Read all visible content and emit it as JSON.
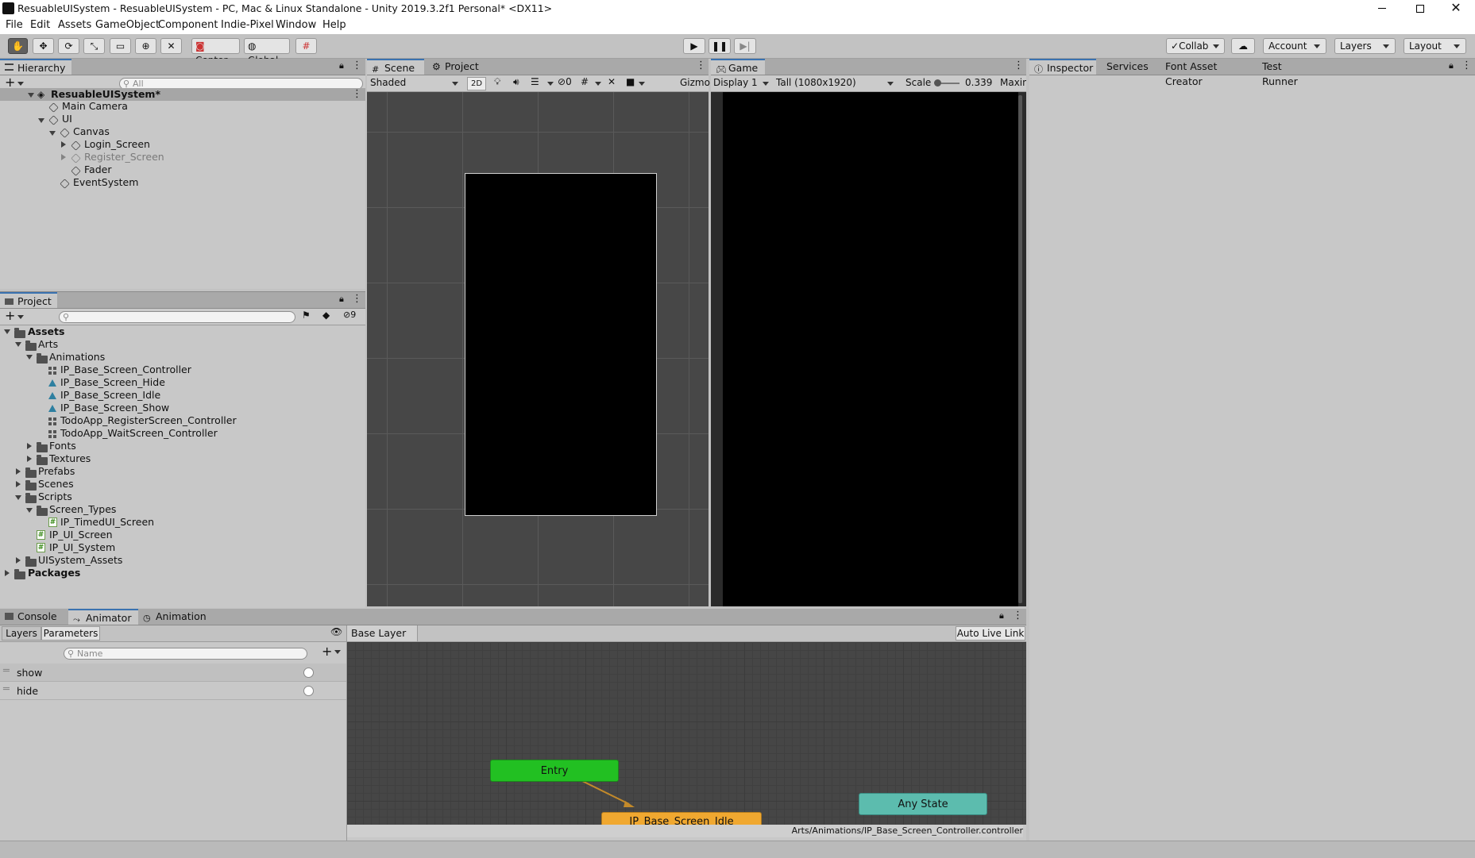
{
  "window": {
    "title": "ResuableUISystem - ResuableUISystem - PC, Mac & Linux Standalone - Unity 2019.3.2f1 Personal* <DX11>"
  },
  "menu": [
    "File",
    "Edit",
    "Assets",
    "GameObject",
    "Component",
    "Indie-Pixel",
    "Window",
    "Help"
  ],
  "toolbar": {
    "pivot": "Center",
    "space": "Global",
    "collab": "Collab",
    "account": "Account",
    "layers": "Layers",
    "layout": "Layout"
  },
  "hierarchy": {
    "tab": "Hierarchy",
    "search_placeholder": "All",
    "items": [
      {
        "label": "ResuableUISystem*"
      },
      {
        "label": "Main Camera"
      },
      {
        "label": "UI"
      },
      {
        "label": "Canvas"
      },
      {
        "label": "Login_Screen"
      },
      {
        "label": "Register_Screen"
      },
      {
        "label": "Fader"
      },
      {
        "label": "EventSystem"
      }
    ]
  },
  "project": {
    "tab": "Project",
    "hidden_count": "9",
    "items": [
      {
        "label": "Assets"
      },
      {
        "label": "Arts"
      },
      {
        "label": "Animations"
      },
      {
        "label": "IP_Base_Screen_Controller"
      },
      {
        "label": "IP_Base_Screen_Hide"
      },
      {
        "label": "IP_Base_Screen_Idle"
      },
      {
        "label": "IP_Base_Screen_Show"
      },
      {
        "label": "TodoApp_RegisterScreen_Controller"
      },
      {
        "label": "TodoApp_WaitScreen_Controller"
      },
      {
        "label": "Fonts"
      },
      {
        "label": "Textures"
      },
      {
        "label": "Prefabs"
      },
      {
        "label": "Scenes"
      },
      {
        "label": "Scripts"
      },
      {
        "label": "Screen_Types"
      },
      {
        "label": "IP_TimedUI_Screen"
      },
      {
        "label": "IP_UI_Screen"
      },
      {
        "label": "IP_UI_System"
      },
      {
        "label": "UISystem_Assets"
      },
      {
        "label": "Packages"
      }
    ]
  },
  "scene": {
    "tab": "Scene",
    "tab2": "Project Settings",
    "shading": "Shaded",
    "mode_2d": "2D",
    "hidden": "0",
    "gizmos": "Gizmo"
  },
  "game": {
    "tab": "Game",
    "display": "Display 1",
    "resolution": "Tall (1080x1920)",
    "scale_label": "Scale",
    "scale_value": "0.339",
    "maximize": "Maxin"
  },
  "inspector": {
    "tabs": [
      "Inspector",
      "Services",
      "Font Asset Creator",
      "Test Runner"
    ]
  },
  "bottom": {
    "tabs": [
      "Console",
      "Animator",
      "Animation"
    ],
    "subtabs": [
      "Layers",
      "Parameters"
    ],
    "name_placeholder": "Name",
    "params": [
      {
        "label": "show"
      },
      {
        "label": "hide"
      }
    ],
    "breadcrumb": "Base Layer",
    "auto_live_link": "Auto Live Link",
    "nodes": {
      "entry": "Entry",
      "idle": "IP_Base_Screen_Idle",
      "any": "Any State"
    },
    "path": "Arts/Animations/IP_Base_Screen_Controller.controller"
  },
  "colors": {
    "entry": "#22c022",
    "default_state": "#f0a830",
    "any_state": "#5cbcae"
  }
}
